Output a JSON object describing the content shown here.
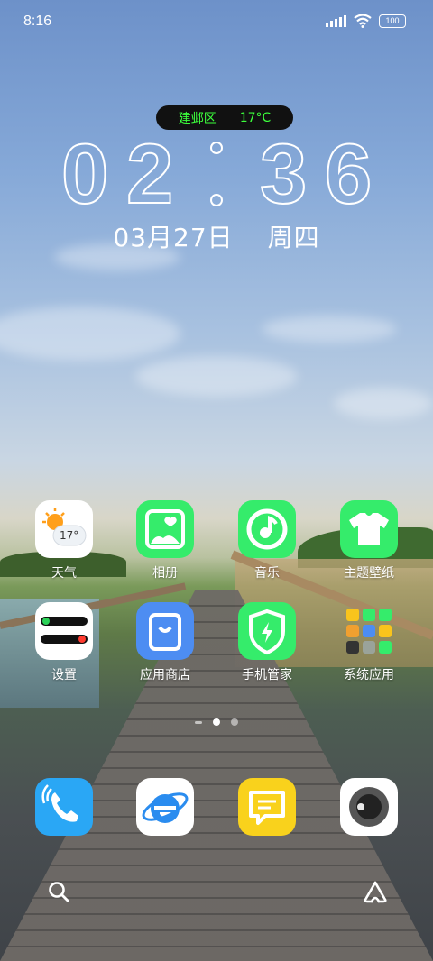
{
  "status_bar": {
    "time": "8:16",
    "battery": "100",
    "icons": [
      "signal-icon",
      "wifi-icon",
      "battery-icon"
    ]
  },
  "clock_widget": {
    "location": "建邺区",
    "temperature": "17°C",
    "hour_digits": [
      "0",
      "2"
    ],
    "minute_digits": [
      "3",
      "6"
    ],
    "date": "03月27日",
    "weekday": "周四"
  },
  "home_apps": [
    {
      "label": "天气",
      "icon": "weather-icon",
      "badge": "17°"
    },
    {
      "label": "相册",
      "icon": "album-icon"
    },
    {
      "label": "音乐",
      "icon": "music-icon"
    },
    {
      "label": "主题壁纸",
      "icon": "theme-icon"
    },
    {
      "label": "设置",
      "icon": "settings-icon"
    },
    {
      "label": "应用商店",
      "icon": "app-store-icon"
    },
    {
      "label": "手机管家",
      "icon": "security-icon"
    },
    {
      "label": "系统应用",
      "icon": "folder-icon"
    }
  ],
  "dock": [
    {
      "icon": "phone-icon"
    },
    {
      "icon": "browser-icon"
    },
    {
      "icon": "message-icon"
    },
    {
      "icon": "camera-icon"
    }
  ],
  "pager": {
    "pages": 3,
    "active": 2
  },
  "colors": {
    "accent_green": "#35ec6b",
    "pill_text": "#3cff3c",
    "store_blue": "#4d8df2",
    "phone_blue": "#2aa7f5",
    "msg_yellow": "#f9d21c"
  }
}
